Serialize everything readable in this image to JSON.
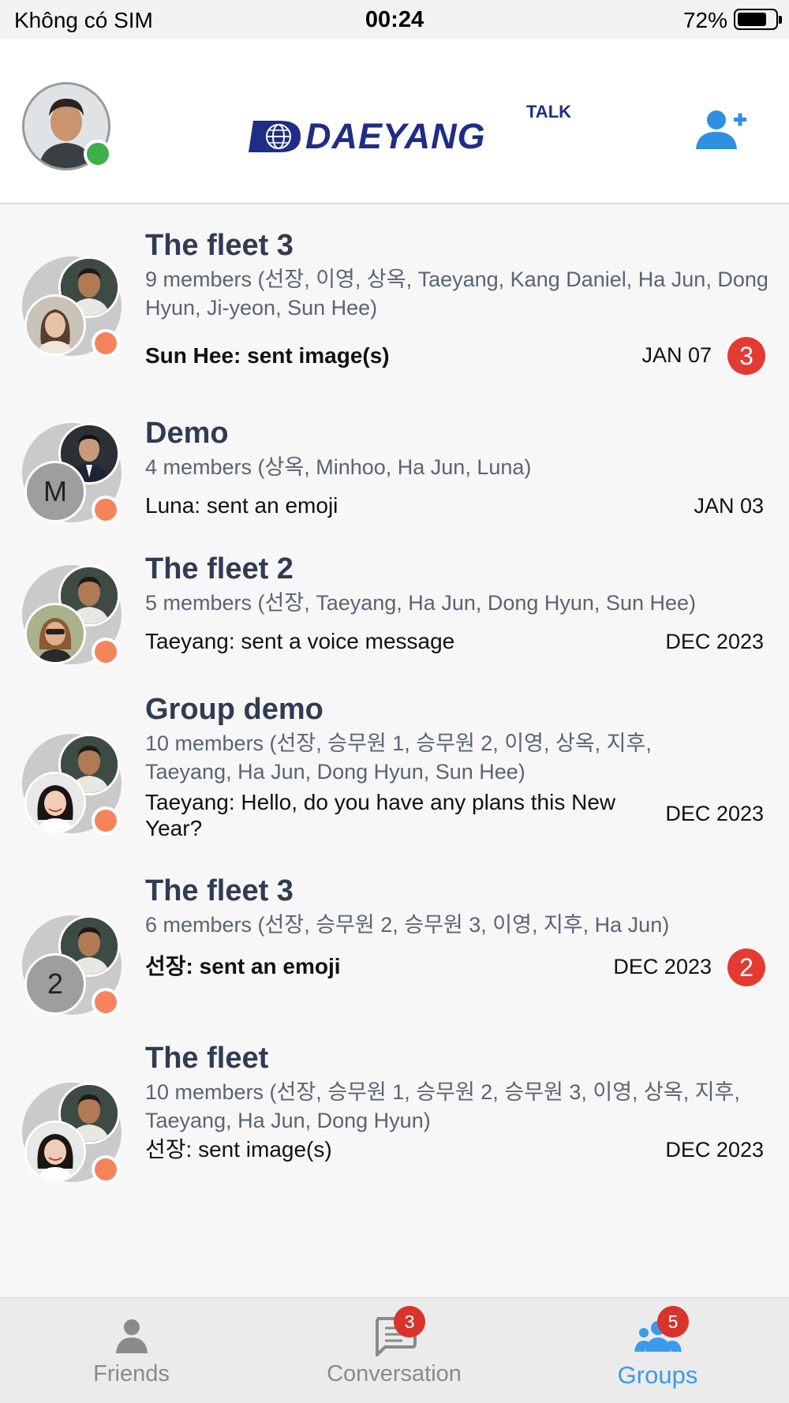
{
  "status_bar": {
    "carrier": "Không có SIM",
    "time": "00:24",
    "battery": "72%"
  },
  "header": {
    "logo_main": "DAEYANG",
    "logo_sup": "TALK",
    "icons": {
      "profile": "user-avatar",
      "add": "add-friend-icon"
    }
  },
  "groups": [
    {
      "name": "The fleet 3",
      "members": "9 members (선장, 이영, 상옥, Taeyang, Kang Daniel, Ha Jun, Dong Hyun, Ji-yeon, Sun Hee)",
      "last": "Sun Hee: sent image(s)",
      "date": "JAN 07",
      "unread": "3",
      "bold": true,
      "avatar_letter": ""
    },
    {
      "name": "Demo",
      "members": "4 members (상옥, Minhoo, Ha Jun, Luna)",
      "last": "Luna: sent an emoji",
      "date": "JAN 03",
      "unread": "",
      "bold": false,
      "avatar_letter": "M"
    },
    {
      "name": "The fleet 2",
      "members": "5 members (선장, Taeyang, Ha Jun, Dong Hyun, Sun Hee)",
      "last": "Taeyang: sent a voice message",
      "date": "DEC 2023",
      "unread": "",
      "bold": false,
      "avatar_letter": ""
    },
    {
      "name": "Group demo",
      "members": "10 members (선장, 승무원 1, 승무원 2, 이영, 상옥, 지후, Taeyang, Ha Jun, Dong Hyun, Sun Hee)",
      "last": "Taeyang: Hello, do you have any plans this New Year?",
      "date": "DEC 2023",
      "unread": "",
      "bold": false,
      "avatar_letter": ""
    },
    {
      "name": "The fleet 3",
      "members": "6 members (선장, 승무원 2, 승무원 3, 이영, 지후, Ha Jun)",
      "last": "선장: sent an emoji",
      "date": "DEC 2023",
      "unread": "2",
      "bold": true,
      "avatar_letter": "2"
    },
    {
      "name": "The fleet",
      "members": "10 members (선장, 승무원 1, 승무원 2, 승무원 3, 이영, 상옥, 지후, Taeyang, Ha Jun, Dong Hyun)",
      "last": "선장: sent image(s)",
      "date": "DEC 2023",
      "unread": "",
      "bold": false,
      "avatar_letter": ""
    }
  ],
  "tabs": [
    {
      "label": "Friends",
      "icon": "person-icon",
      "badge": "",
      "active": false
    },
    {
      "label": "Conversation",
      "icon": "chat-icon",
      "badge": "3",
      "active": false
    },
    {
      "label": "Groups",
      "icon": "group-icon",
      "badge": "5",
      "active": true
    }
  ],
  "colors": {
    "accent": "#3a9bea",
    "badge": "#e33b32",
    "online": "#3cb04a",
    "status_dot": "#f5845c",
    "logo": "#1f2d86"
  }
}
